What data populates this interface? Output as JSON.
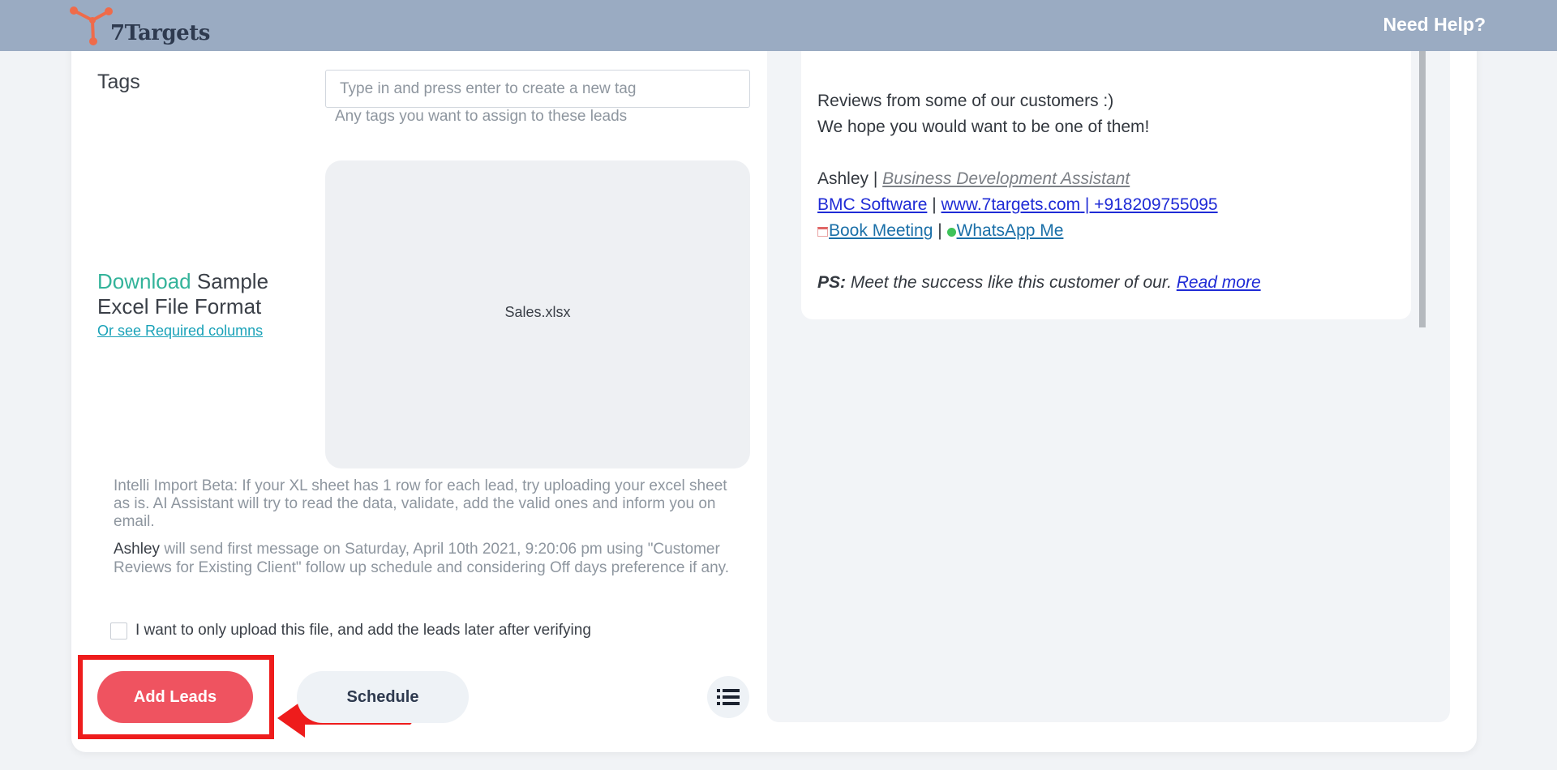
{
  "header": {
    "logo_text": "7Targets",
    "help_label": "Need Help?"
  },
  "form": {
    "tags_label": "Tags",
    "tags_placeholder": "Type in and press enter to create a new tag",
    "tags_help": "Any tags you want to assign to these leads",
    "download_link": "Download",
    "download_rest_1": "Sample",
    "download_rest_2": "Excel File Format",
    "required_columns_link": "Or see Required columns",
    "uploaded_file": "Sales.xlsx",
    "intelli_note": "Intelli Import Beta: If your XL sheet has 1 row for each lead, try uploading your excel sheet as is. AI Assistant will try to read the data, validate, add the valid ones and inform you on email.",
    "sender_name": "Ashley",
    "send_note": "will send first message on Saturday, April 10th 2021, 9:20:06 pm using \"Customer Reviews for Existing Client\" follow up schedule and considering Off days preference if any.",
    "upload_only_label": "I want to only upload this file, and add the leads later after verifying",
    "upload_only_checked": false
  },
  "actions": {
    "add_leads_label": "Add Leads",
    "schedule_label": "Schedule",
    "list_icon": "list-icon"
  },
  "preview": {
    "line1": "Reviews from some of our customers :)",
    "line2": "We hope you would want to be one of them!",
    "sig_name": "Ashley",
    "sig_sep1": " | ",
    "sig_role": "Business Development Assistant",
    "company_link": "BMC Software",
    "sep_a": " | ",
    "website_link": "www.7targets.com",
    "phone_link": " | +918209755095",
    "book_meeting_link": "Book Meeting",
    "sep_b": " | ",
    "whatsapp_link": "WhatsApp Me",
    "ps_label": "PS:",
    "ps_text": " Meet the success like this customer of our. ",
    "read_more_link": "Read more"
  },
  "colors": {
    "header_bg": "#9aabc2",
    "primary_button": "#ef5360",
    "link_teal": "#33b39a",
    "annotation_red": "#ee1c1c"
  }
}
